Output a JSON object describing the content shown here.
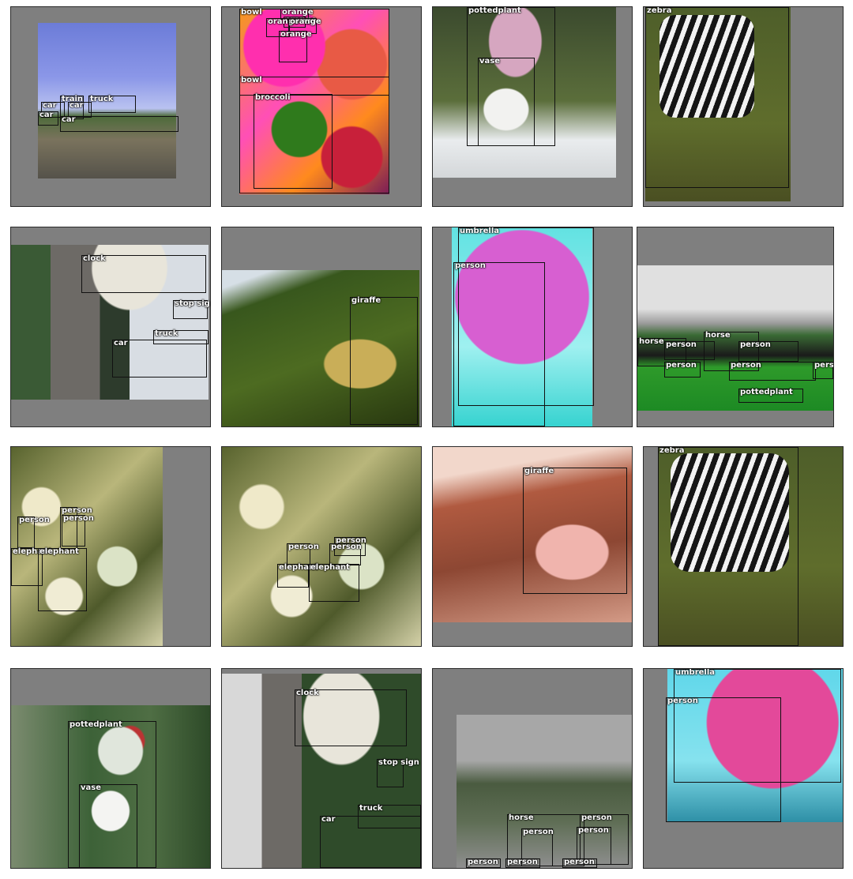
{
  "tiles": [
    {
      "labels": [
        "train",
        "car",
        "car",
        "car",
        "truck",
        "car"
      ]
    },
    {
      "labels": [
        "bowl",
        "orange",
        "orange",
        "orange",
        "orange",
        "orange",
        "bowl",
        "broccoli"
      ]
    },
    {
      "labels": [
        "pottedplant",
        "vase"
      ]
    },
    {
      "labels": [
        "zebra"
      ]
    },
    {
      "labels": [
        "clock",
        "stop sign",
        "truck",
        "car"
      ]
    },
    {
      "labels": [
        "giraffe"
      ]
    },
    {
      "labels": [
        "umbrella",
        "person"
      ]
    },
    {
      "labels": [
        "horse",
        "person",
        "horse",
        "person",
        "person",
        "person",
        "person",
        "pottedplant"
      ]
    },
    {
      "labels": [
        "person",
        "person",
        "person",
        "elephant",
        "elephant"
      ]
    },
    {
      "labels": [
        "person",
        "person",
        "person",
        "elephant",
        "elephant"
      ]
    },
    {
      "labels": [
        "giraffe"
      ]
    },
    {
      "labels": [
        "zebra"
      ]
    },
    {
      "labels": [
        "pottedplant",
        "vase"
      ]
    },
    {
      "labels": [
        "clock",
        "stop sign",
        "truck",
        "car"
      ]
    },
    {
      "labels": [
        "horse",
        "person",
        "person",
        "person",
        "person",
        "person",
        "person"
      ]
    },
    {
      "labels": [
        "umbrella",
        "person"
      ]
    }
  ]
}
